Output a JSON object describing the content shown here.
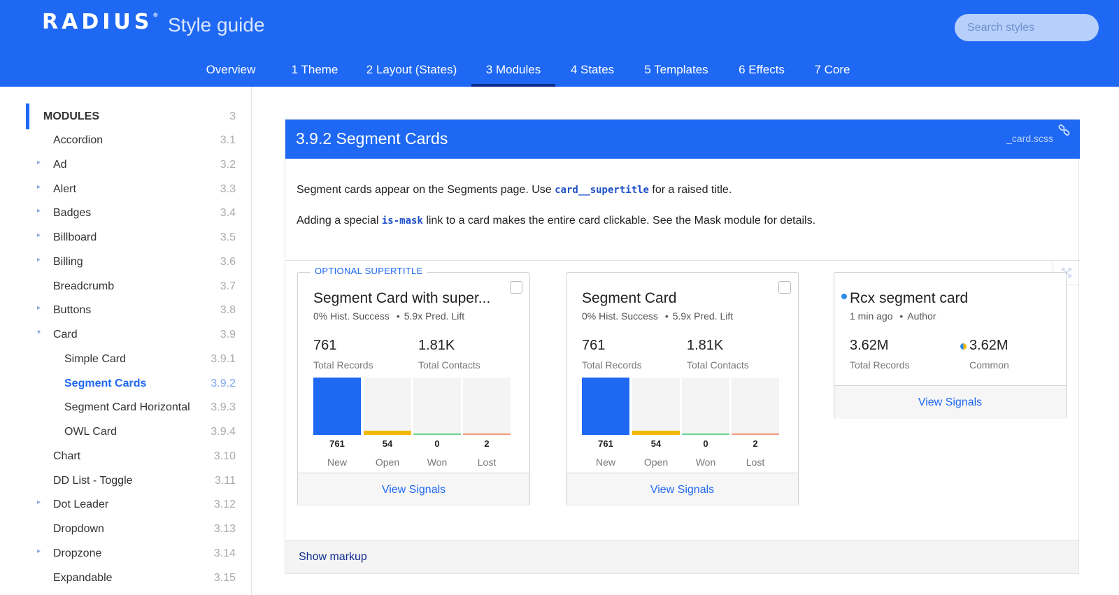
{
  "header": {
    "logo": "RADIUS",
    "logo_mark": "®",
    "title": "Style guide",
    "search_placeholder": "Search styles"
  },
  "nav": {
    "items": [
      "Overview",
      "1 Theme",
      "2 Layout (States)",
      "3 Modules",
      "4 States",
      "5 Templates",
      "6 Effects",
      "7 Core"
    ],
    "active": "3 Modules"
  },
  "sidebar": {
    "heading": {
      "label": "MODULES",
      "num": "3"
    },
    "items": [
      {
        "label": "Accordion",
        "num": "3.1",
        "arrow": ""
      },
      {
        "label": "Ad",
        "num": "3.2",
        "arrow": "▸"
      },
      {
        "label": "Alert",
        "num": "3.3",
        "arrow": "▸"
      },
      {
        "label": "Badges",
        "num": "3.4",
        "arrow": "▸"
      },
      {
        "label": "Billboard",
        "num": "3.5",
        "arrow": "▸"
      },
      {
        "label": "Billing",
        "num": "3.6",
        "arrow": "▸"
      },
      {
        "label": "Breadcrumb",
        "num": "3.7",
        "arrow": ""
      },
      {
        "label": "Buttons",
        "num": "3.8",
        "arrow": "▸"
      },
      {
        "label": "Card",
        "num": "3.9",
        "arrow": "▾"
      },
      {
        "label": "Simple Card",
        "num": "3.9.1",
        "arrow": ""
      },
      {
        "label": "Segment Cards",
        "num": "3.9.2",
        "arrow": ""
      },
      {
        "label": "Segment Card Horizontal",
        "num": "3.9.3",
        "arrow": ""
      },
      {
        "label": "OWL Card",
        "num": "3.9.4",
        "arrow": ""
      },
      {
        "label": "Chart",
        "num": "3.10",
        "arrow": ""
      },
      {
        "label": "DD List - Toggle",
        "num": "3.11",
        "arrow": ""
      },
      {
        "label": "Dot Leader",
        "num": "3.12",
        "arrow": "▸"
      },
      {
        "label": "Dropdown",
        "num": "3.13",
        "arrow": ""
      },
      {
        "label": "Dropzone",
        "num": "3.14",
        "arrow": "▸"
      },
      {
        "label": "Expandable",
        "num": "3.15",
        "arrow": ""
      }
    ]
  },
  "section": {
    "title": "3.9.2 Segment Cards",
    "file": "_card.scss",
    "desc1_pre": "Segment cards appear on the Segments page. Use ",
    "desc1_code": "card__supertitle",
    "desc1_post": " for a raised title.",
    "desc2_pre": "Adding a special ",
    "desc2_code": "is-mask",
    "desc2_post": " link to a card makes the entire card clickable. See the Mask module for details.",
    "show_markup": "Show markup"
  },
  "cards": [
    {
      "supertitle": "OPTIONAL SUPERTITLE",
      "title": "Segment Card with super...",
      "sub1": "0% Hist. Success",
      "sub_sep": "•",
      "sub2": "5.9x Pred. Lift",
      "m1_value": "761",
      "m1_label": "Total Records",
      "m2_value": "1.81K",
      "m2_label": "Total Contacts",
      "bars": [
        {
          "value": "761",
          "label": "New",
          "fill": 1.0
        },
        {
          "value": "54",
          "label": "Open",
          "fill": 0.071
        },
        {
          "value": "0",
          "label": "Won",
          "fill": 0
        },
        {
          "value": "2",
          "label": "Lost",
          "fill": 0.003
        }
      ],
      "footer": "View Signals"
    },
    {
      "title": "Segment Card",
      "sub1": "0% Hist. Success",
      "sub_sep": "•",
      "sub2": "5.9x Pred. Lift",
      "m1_value": "761",
      "m1_label": "Total Records",
      "m2_value": "1.81K",
      "m2_label": "Total Contacts",
      "bars": [
        {
          "value": "761",
          "label": "New",
          "fill": 1.0
        },
        {
          "value": "54",
          "label": "Open",
          "fill": 0.071
        },
        {
          "value": "0",
          "label": "Won",
          "fill": 0
        },
        {
          "value": "2",
          "label": "Lost",
          "fill": 0.003
        }
      ],
      "footer": "View Signals"
    },
    {
      "title": "Rcx segment card",
      "sub1": "1 min ago",
      "sub_sep": "•",
      "sub2": "Author",
      "m1_value": "3.62M",
      "m1_label": "Total Records",
      "m2_value": "3.62M",
      "m2_label": "Common",
      "footer": "View Signals"
    }
  ],
  "colors": {
    "brand_blue": "#1e68f4",
    "bar_new": "#1e68f4",
    "bar_open": "#f5b800",
    "bar_won": "#6cd394",
    "bar_lost": "#f29b7a"
  },
  "icons": [
    "link-icon",
    "expand-icon",
    "checkbox-icon",
    "chevron-right-icon",
    "chevron-down-icon",
    "status-dot-icon",
    "multicolor-dot-icon"
  ]
}
